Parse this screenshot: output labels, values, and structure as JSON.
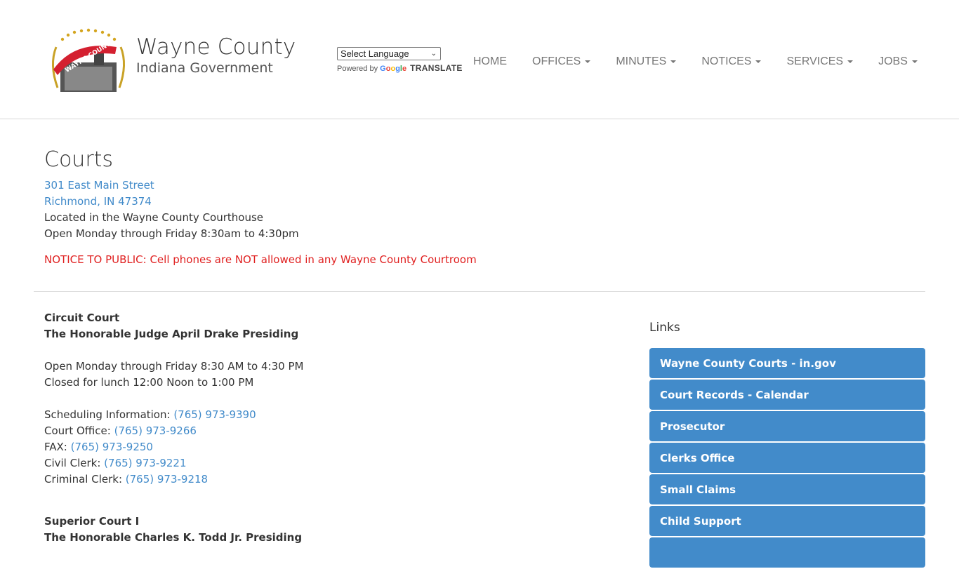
{
  "header": {
    "brand_title": "Wayne County",
    "brand_subtitle": "Indiana Government",
    "logo_ribbon_text": "WAYNE COUNTY",
    "translate": {
      "select_value": "Select Language",
      "powered_by": "Powered by",
      "google": [
        "G",
        "o",
        "o",
        "g",
        "l",
        "e"
      ],
      "google_colors": [
        "#4285f4",
        "#ea4335",
        "#fbbc05",
        "#4285f4",
        "#34a853",
        "#ea4335"
      ],
      "translate_word": "TRANSLATE"
    },
    "nav": [
      {
        "label": "HOME",
        "dropdown": false
      },
      {
        "label": "OFFICES",
        "dropdown": true
      },
      {
        "label": "MINUTES",
        "dropdown": true
      },
      {
        "label": "NOTICES",
        "dropdown": true
      },
      {
        "label": "SERVICES",
        "dropdown": true
      },
      {
        "label": "JOBS",
        "dropdown": true
      }
    ]
  },
  "page": {
    "title": "Courts",
    "address_line1": "301 East Main Street",
    "address_line2": "Richmond, IN 47374",
    "location": "Located in the Wayne County Courthouse",
    "hours": "Open Monday through Friday 8:30am to 4:30pm",
    "notice": "NOTICE TO PUBLIC: Cell phones are NOT allowed in any Wayne County Courtroom"
  },
  "circuit_court": {
    "name": "Circuit Court",
    "judge": "The Honorable Judge April Drake Presiding",
    "hours": "Open Monday through Friday 8:30 AM to 4:30 PM",
    "lunch": "Closed for lunch 12:00 Noon to 1:00 PM",
    "contacts": [
      {
        "label": "Scheduling Information: ",
        "phone": "(765) 973-9390"
      },
      {
        "label": "Court Office: ",
        "phone": "(765) 973-9266"
      },
      {
        "label": "FAX: ",
        "phone": "(765) 973-9250"
      },
      {
        "label": "Civil Clerk: ",
        "phone": "(765) 973-9221"
      },
      {
        "label": "Criminal Clerk: ",
        "phone": "(765) 973-9218"
      }
    ]
  },
  "superior_court_1": {
    "name": "Superior Court I",
    "judge": "The Honorable Charles K. Todd Jr. Presiding"
  },
  "links": {
    "title": "Links",
    "items": [
      "Wayne County Courts - in.gov",
      "Court Records - Calendar",
      "Prosecutor",
      "Clerks Office",
      "Small Claims",
      "Child Support",
      ""
    ]
  },
  "colors": {
    "link": "#428bca",
    "button_bg": "#428bca",
    "notice": "#e02020"
  }
}
